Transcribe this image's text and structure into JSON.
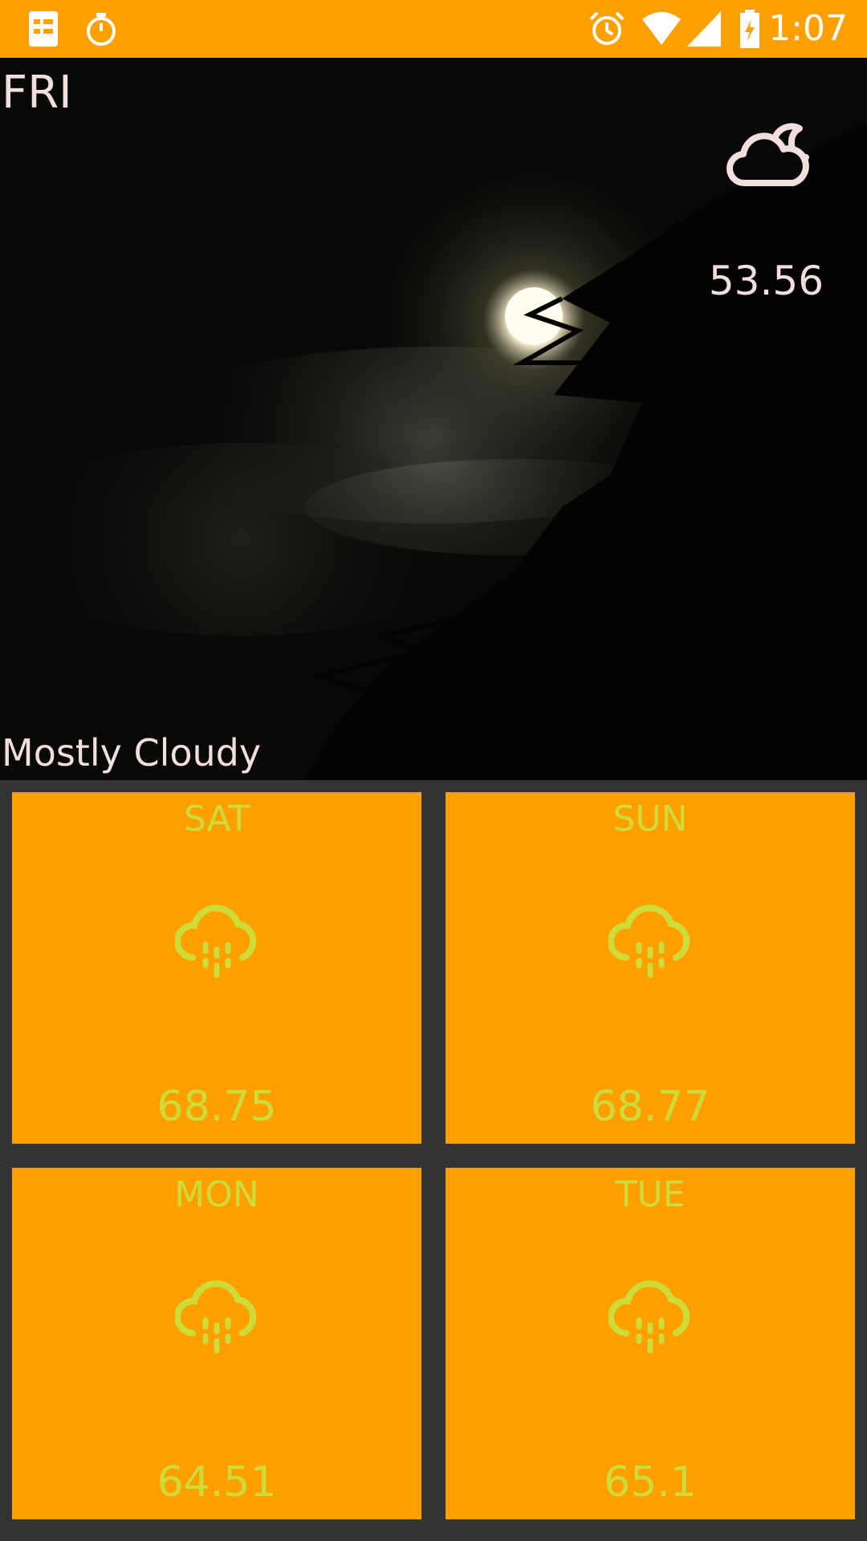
{
  "status_bar": {
    "time": "1:07",
    "left_icons": [
      "notes-icon",
      "stopwatch-icon"
    ],
    "right_icons": [
      "alarm-icon",
      "wifi-icon",
      "signal-icon",
      "battery-charging-icon"
    ]
  },
  "today": {
    "day": "FRI",
    "temperature": "53.56",
    "condition": "Mostly Cloudy",
    "icon": "partly-cloudy-night-icon"
  },
  "forecast": [
    {
      "day": "SAT",
      "temperature": "68.75",
      "icon": "rain-icon"
    },
    {
      "day": "SUN",
      "temperature": "68.77",
      "icon": "rain-icon"
    },
    {
      "day": "MON",
      "temperature": "64.51",
      "icon": "rain-icon"
    },
    {
      "day": "TUE",
      "temperature": "65.1",
      "icon": "rain-icon"
    }
  ],
  "colors": {
    "status_bar": "#FFA000",
    "card_background": "#FFA000",
    "card_text": "#CDDC39",
    "hero_text": "#F3DEDE",
    "grid_background": "#333333"
  }
}
